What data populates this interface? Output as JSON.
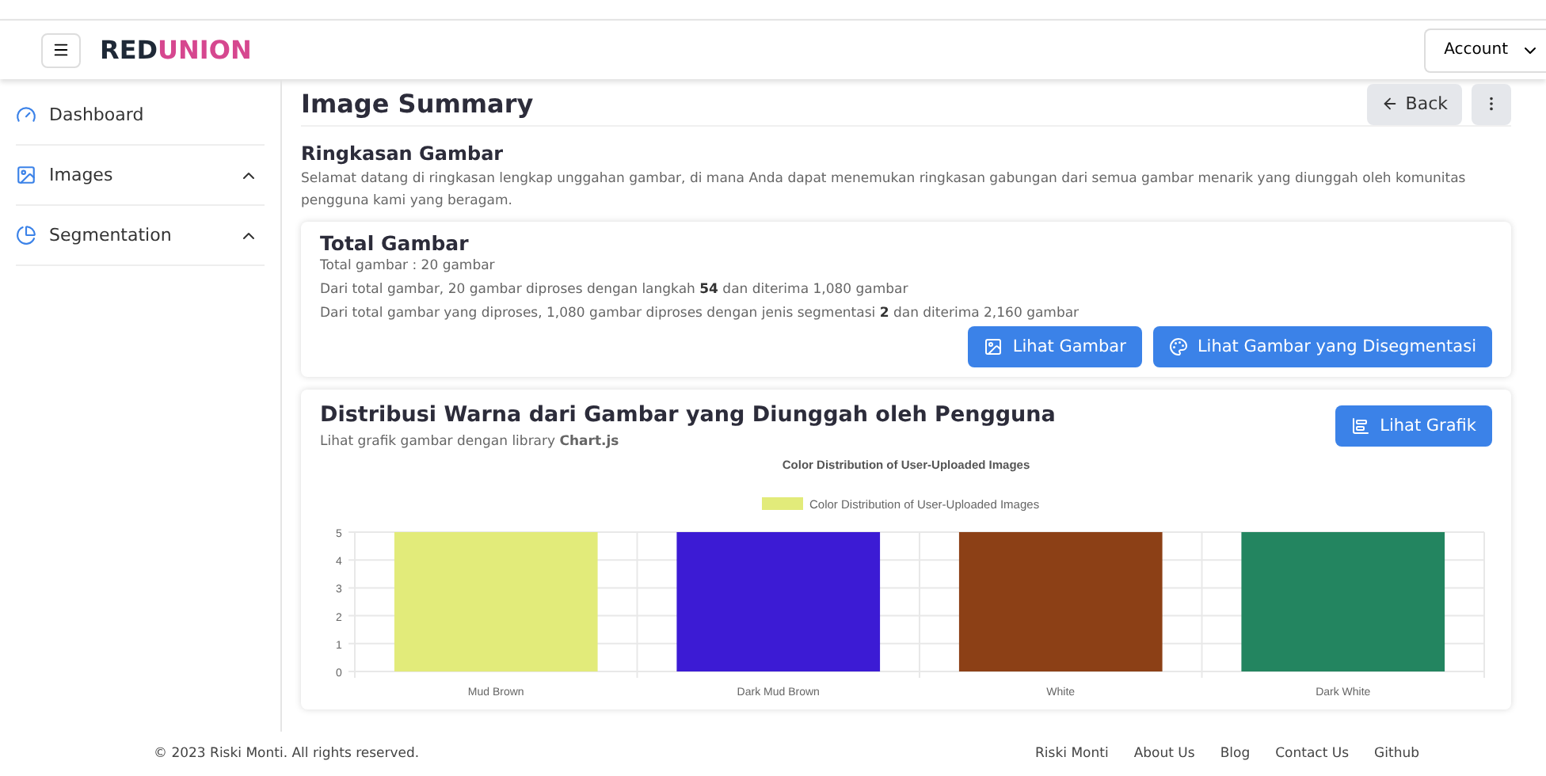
{
  "header": {
    "brand": [
      {
        "text": "RED",
        "color": "#1f2937"
      },
      {
        "text": "UNION",
        "color": "#d6478f"
      }
    ],
    "account": "Account"
  },
  "sidebar": {
    "items": [
      {
        "label": "Dashboard"
      },
      {
        "label": "Images",
        "expanded": false
      },
      {
        "label": "Segmentation",
        "expanded": false
      }
    ]
  },
  "page": {
    "title": "Image Summary",
    "back": "Back"
  },
  "summary": {
    "title": "Ringkasan Gambar",
    "text": "Selamat datang di ringkasan lengkap unggahan gambar, di mana Anda dapat menemukan ringkasan gabungan dari semua gambar menarik yang diunggah oleh komunitas pengguna kami yang beragam."
  },
  "total": {
    "title": "Total Gambar",
    "lines": [
      "Total gambar : 20 gambar",
      "Dari total gambar, 20 gambar diproses dengan langkah **54** dan diterima 1,080 gambar",
      "Dari total gambar yang diproses, 1,080 gambar diproses dengan jenis segmentasi **2** dan diterima 2,160 gambar"
    ],
    "buttons": [
      {
        "label": "Lihat Gambar"
      },
      {
        "label": "Lihat Gambar yang Disegmentasi"
      }
    ]
  },
  "distribution": {
    "title": "Distribusi Warna dari Gambar yang Diunggah oleh Pengguna",
    "subtitle": "Lihat grafik gambar dengan library **Chart.js**",
    "button": "Lihat Grafik",
    "chart_data": {
      "type": "bar",
      "title": "Color Distribution of User-Uploaded Images",
      "categories": [
        "Mud Brown",
        "Dark Mud Brown",
        "White",
        "Dark White"
      ],
      "series": [
        {
          "name": "Color Distribution of User-Uploaded Images",
          "colors": [
            "#e2eb7a",
            "#3c1bd4",
            "#8c4016",
            "#238560"
          ],
          "values": [
            5,
            5,
            5,
            5
          ]
        }
      ],
      "ylim": [
        0,
        5
      ],
      "yticks": [
        0,
        1,
        2,
        3,
        4,
        5
      ],
      "grid": true
    }
  },
  "footer": {
    "copyright": "© 2023 Riski Monti. All rights reserved.",
    "links": [
      "Riski Monti",
      "About Us",
      "Blog",
      "Contact Us",
      "Github"
    ]
  }
}
